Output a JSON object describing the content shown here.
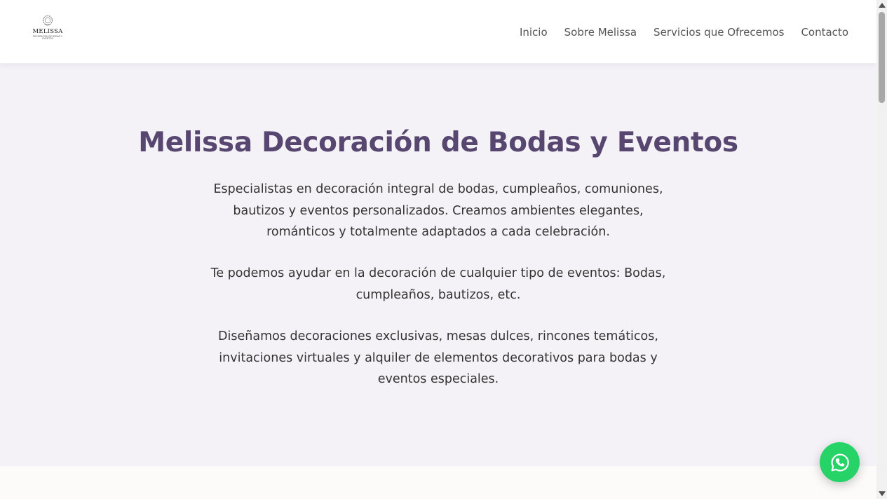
{
  "header": {
    "logo": {
      "name": "MELISSA",
      "tagline": "DECORACIÓN DE BODAS Y EVENTOS",
      "icon": "wreath-logo-icon"
    },
    "nav": [
      {
        "label": "Inicio"
      },
      {
        "label": "Sobre Melissa"
      },
      {
        "label": "Servicios que Ofrecemos"
      },
      {
        "label": "Contacto"
      }
    ]
  },
  "hero": {
    "title": "Melissa Decoración de Bodas y Eventos",
    "paragraphs": [
      "Especialistas en decoración integral de bodas, cumpleaños, comuniones, bautizos y eventos personalizados. Creamos ambientes elegantes, románticos y totalmente adaptados a cada celebración.",
      "Te podemos ayudar en la decoración de cualquier tipo de eventos: Bodas, cumpleaños, bautizos, etc.",
      "Diseñamos decoraciones exclusivas, mesas dulces, rincones temáticos, invitaciones virtuales y alquiler de elementos decorativos para bodas y eventos especiales."
    ]
  },
  "floating": {
    "whatsapp_icon": "whatsapp-icon"
  },
  "colors": {
    "title": "#574670",
    "hero_bg": "#f4f2f7",
    "whatsapp": "#25d366"
  }
}
